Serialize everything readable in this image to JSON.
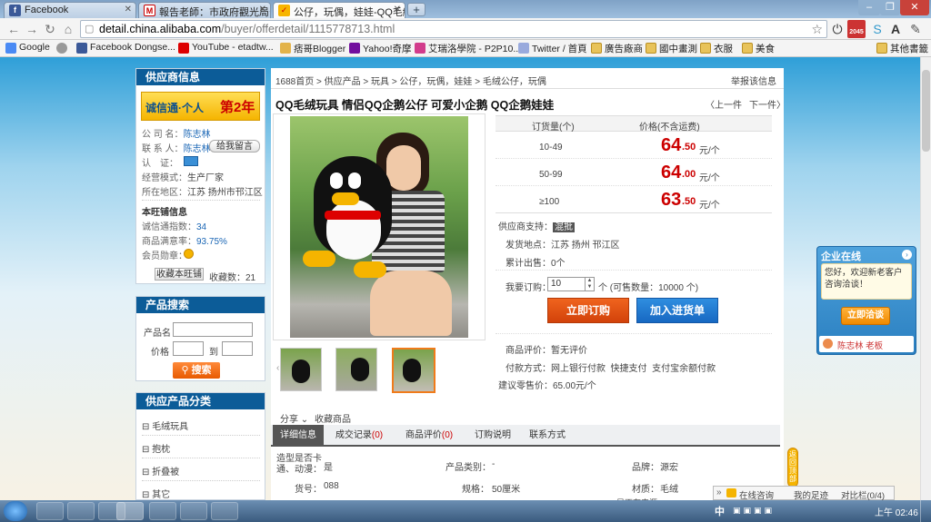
{
  "browser": {
    "tabs": [
      {
        "label": "Facebook",
        "icon": "facebook-icon"
      },
      {
        "label": "報告老師：市政府觀光局公",
        "icon": "gmail-icon"
      },
      {
        "label": "公仔，玩偶，娃娃-QQ毛絨",
        "icon": "alibaba-icon"
      }
    ],
    "url_domain": "detail.china.alibaba.com",
    "url_path": "/buyer/offerdetail/1115778713.html",
    "bookmarks": [
      "Google",
      "Facebook Dongse...",
      "YouTube - etadtw...",
      "痞哥Blogger",
      "Yahoo!奇摩",
      "艾瑞洛學院 - P2P10...",
      "Twitter / 首頁",
      "廣告廠商",
      "國中畫測",
      "衣服",
      "美食",
      "其他書籤"
    ],
    "badge": "2045"
  },
  "supplier": {
    "title": "供应商信息",
    "banner_brand": "诚信通·个人",
    "banner_year": "第2年",
    "company_label": "公 司 名：",
    "company_value": "陈志林",
    "contact_label": "联 系 人：",
    "contact_value": "陈志林",
    "message_btn": "给我留言",
    "auth_label": "认　证：",
    "model_label": "经营模式：",
    "model_value": "生产厂家",
    "area_label": "所在地区：",
    "area_value": "江苏 扬州市邗江区",
    "wangpu_title": "本旺铺信息",
    "index_label": "诚信通指数：",
    "index_value": "34",
    "rating_label": "商品满意率：",
    "rating_value": "93.75%",
    "medal_label": "会员勋章：",
    "fav_btn": "收藏本旺铺",
    "fav_count": "收藏数：21"
  },
  "search": {
    "title": "产品搜索",
    "name_label": "产品名",
    "price_label": "价格",
    "to_label": "到",
    "btn": "搜索"
  },
  "categories": {
    "title": "供应产品分类",
    "items": [
      "毛绒玩具",
      "抱枕",
      "折叠被",
      "其它"
    ]
  },
  "breadcrumb": "1688首页 > 供应产品 > 玩具 > 公仔，玩偶，娃娃 > 毛绒公仔，玩偶",
  "report": "举报该信息",
  "product_title": "QQ毛绒玩具 情侣QQ企鹅公仔 可爱小企鹅 QQ企鹅娃娃",
  "prev": "〈上一件",
  "next": "下一件〉",
  "share": "分享",
  "collect": "收藏商品",
  "pricing": {
    "qty_header": "订货量(个)",
    "price_header": "价格(不含运费)",
    "unit": "元/个",
    "tiers": [
      {
        "qty": "10-49",
        "big": "64",
        "small": ".50"
      },
      {
        "qty": "50-99",
        "big": "64",
        "small": ".00"
      },
      {
        "qty": "≥100",
        "big": "63",
        "small": ".50"
      }
    ]
  },
  "info": {
    "support_label": "供应商支持：",
    "support_value": "混批",
    "ship_label": "发货地点：",
    "ship_value": "江苏 扬州 邗江区",
    "sold_label": "累计出售：",
    "sold_value": "0个",
    "order_label": "我要订购：",
    "order_value": "10",
    "order_avail": "个 (可售数量：10000 个)",
    "buy_btn": "立即订购",
    "cart_btn": "加入进货单",
    "eval_label": "商品评价：",
    "eval_value": "暂无评价",
    "pay_label": "付款方式：",
    "pay_value": "网上银行付款  快捷支付  支付宝余额付款",
    "retail_label": "建议零售价：",
    "retail_value": "65.00元/个"
  },
  "detail_tabs": [
    {
      "label": "详细信息",
      "count": ""
    },
    {
      "label": "成交记录",
      "count": "(0)"
    },
    {
      "label": "商品评价",
      "count": "(0)"
    },
    {
      "label": "订购说明",
      "count": ""
    },
    {
      "label": "联系方式",
      "count": ""
    }
  ],
  "attrs": {
    "r1": [
      {
        "k": "造型是否卡通、动漫：",
        "v": "是"
      },
      {
        "k": "产品类别：",
        "v": "-"
      },
      {
        "k": "品牌：",
        "v": "源宏"
      }
    ],
    "r2": [
      {
        "k": "货号：",
        "v": "088"
      },
      {
        "k": "规格：",
        "v": "50厘米"
      },
      {
        "k": "材质：",
        "v": "毛绒"
      }
    ],
    "r3": "是否有来源"
  },
  "chat": {
    "title": "企业在线",
    "text": "您好，欢迎新老客户咨询洽谈！",
    "btn": "立即洽谈",
    "user": "陈志林 老板"
  },
  "bottom_bar": {
    "consult": "在线咨询",
    "footprint": "我的足迹",
    "compare": "对比栏(0/4)"
  },
  "side_tab": "返回顶部",
  "taskbar": {
    "ime": "中",
    "time": "上午 02:46"
  }
}
